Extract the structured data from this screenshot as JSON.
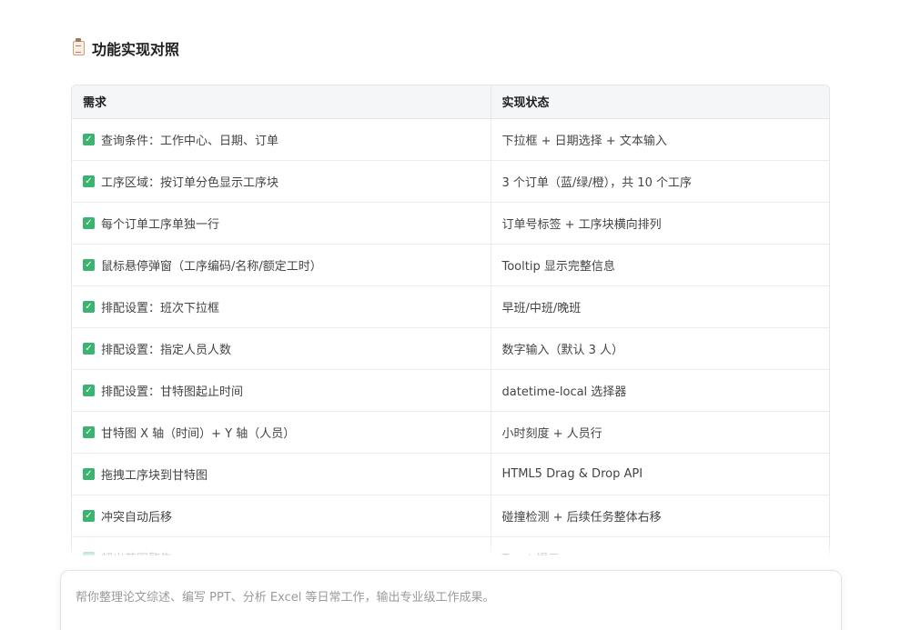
{
  "section": {
    "icon": "clipboard-icon",
    "title": "功能实现对照"
  },
  "table": {
    "headers": [
      "需求",
      "实现状态"
    ],
    "check_icon": "check-box-icon",
    "check_color": "#3cb371",
    "rows": [
      {
        "requirement": "查询条件：工作中心、日期、订单",
        "status": "下拉框 + 日期选择 + 文本输入"
      },
      {
        "requirement": "工序区域：按订单分色显示工序块",
        "status": "3 个订单（蓝/绿/橙），共 10 个工序"
      },
      {
        "requirement": "每个订单工序单独一行",
        "status": "订单号标签 + 工序块横向排列"
      },
      {
        "requirement": "鼠标悬停弹窗（工序编码/名称/额定工时）",
        "status": "Tooltip 显示完整信息"
      },
      {
        "requirement": "排配设置：班次下拉框",
        "status": "早班/中班/晚班"
      },
      {
        "requirement": "排配设置：指定人员人数",
        "status": "数字输入（默认 3 人）"
      },
      {
        "requirement": "排配设置：甘特图起止时间",
        "status": "datetime-local 选择器"
      },
      {
        "requirement": "甘特图 X 轴（时间）+ Y 轴（人员）",
        "status": "小时刻度 + 人员行"
      },
      {
        "requirement": "拖拽工序块到甘特图",
        "status": "HTML5 Drag & Drop API"
      },
      {
        "requirement": "冲突自动后移",
        "status": "碰撞检测 + 后续任务整体右移"
      },
      {
        "requirement": "超出范围警告",
        "status": "Toast 提示"
      }
    ]
  },
  "chat_input": {
    "placeholder": "帮你整理论文综述、编写 PPT、分析 Excel 等日常工作，输出专业级工作成果。"
  }
}
